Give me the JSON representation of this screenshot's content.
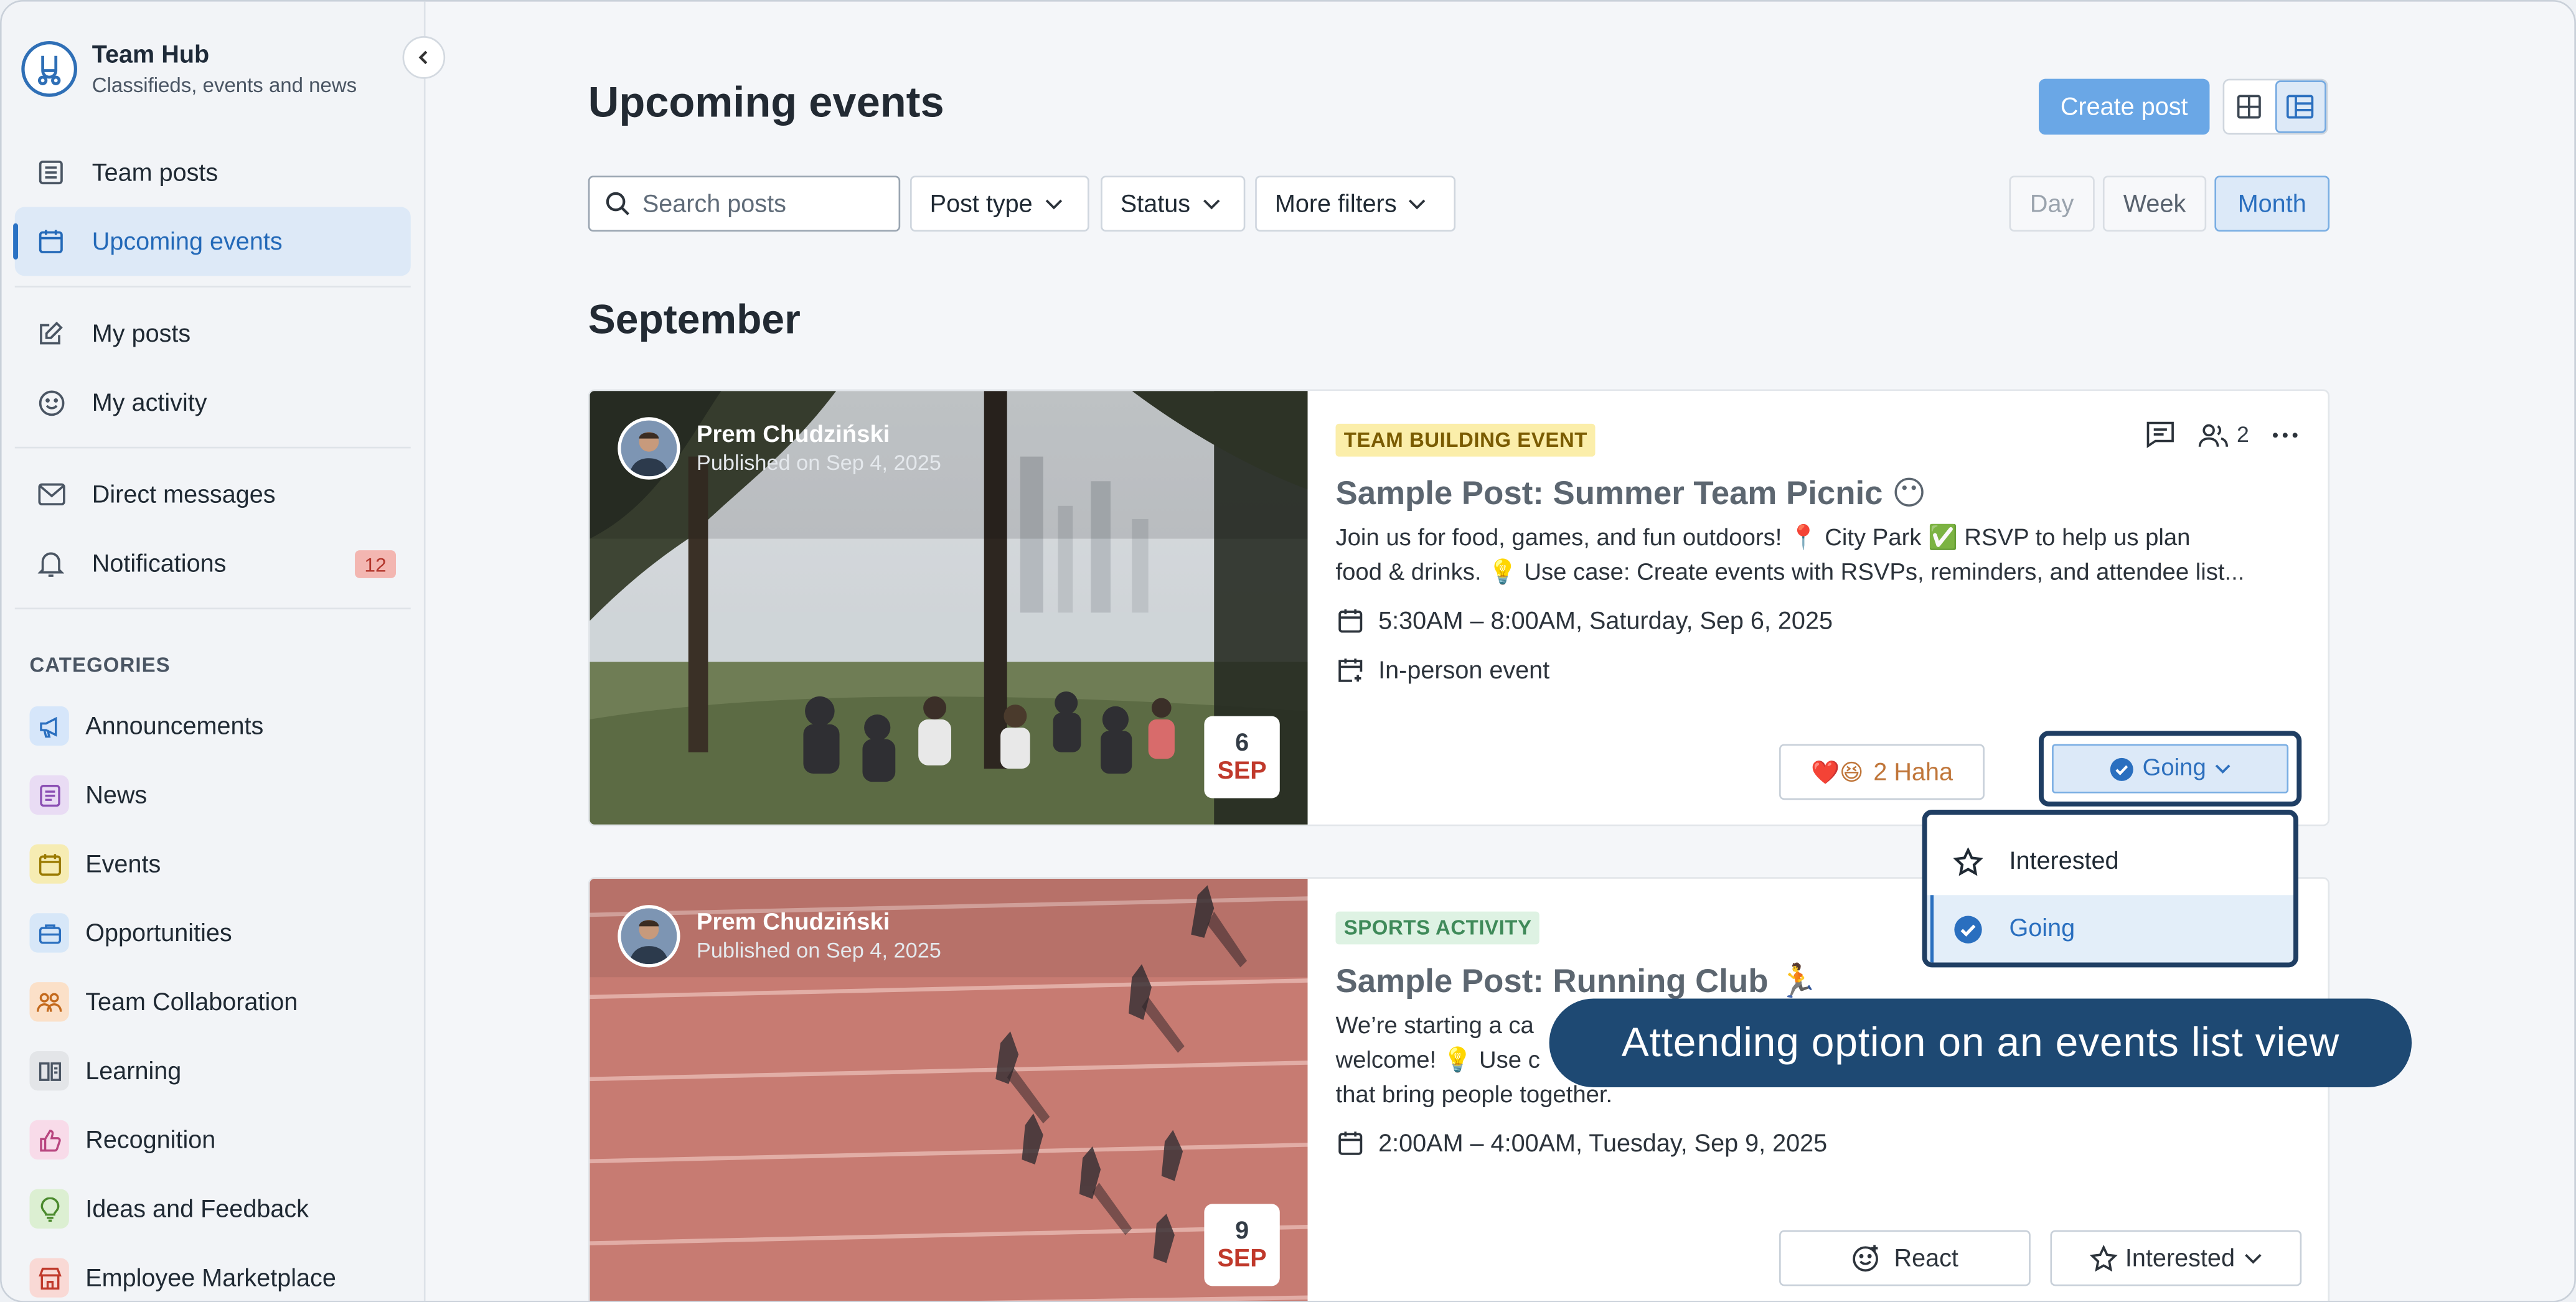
{
  "app": {
    "title": "Team Hub",
    "subtitle": "Classifieds, events and news"
  },
  "sidebar": {
    "nav": [
      {
        "label": "Team posts",
        "icon": "list-icon"
      },
      {
        "label": "Upcoming events",
        "icon": "calendar-icon",
        "active": true
      },
      {
        "label": "My posts",
        "icon": "edit-icon"
      },
      {
        "label": "My activity",
        "icon": "smile-icon"
      },
      {
        "label": "Direct messages",
        "icon": "mail-icon"
      },
      {
        "label": "Notifications",
        "icon": "bell-icon",
        "badge": "12"
      }
    ],
    "categories_title": "CATEGORIES",
    "categories": [
      {
        "label": "Announcements",
        "icon": "megaphone-icon",
        "color": "#d6e6fa"
      },
      {
        "label": "News",
        "icon": "document-icon",
        "color": "#e9dcf4"
      },
      {
        "label": "Events",
        "icon": "calendar-icon",
        "color": "#f6ecb3"
      },
      {
        "label": "Opportunities",
        "icon": "briefcase-icon",
        "color": "#d7e7f8"
      },
      {
        "label": "Team Collaboration",
        "icon": "people-icon",
        "color": "#fbe0c8"
      },
      {
        "label": "Learning",
        "icon": "book-icon",
        "color": "#e3e5e8"
      },
      {
        "label": "Recognition",
        "icon": "thumbs-up-icon",
        "color": "#f8dbe9"
      },
      {
        "label": "Ideas and Feedback",
        "icon": "lightbulb-icon",
        "color": "#dcefd2"
      },
      {
        "label": "Employee Marketplace",
        "icon": "store-icon",
        "color": "#f9d9d5"
      }
    ]
  },
  "header": {
    "title": "Upcoming events",
    "create_label": "Create post"
  },
  "filters": {
    "search_placeholder": "Search posts",
    "post_type": "Post type",
    "status": "Status",
    "more": "More filters",
    "ranges": [
      "Day",
      "Week",
      "Month"
    ],
    "active_range": "Month"
  },
  "section": {
    "month": "September"
  },
  "posts": [
    {
      "author": "Prem Chudziński",
      "published": "Published on Sep 4, 2025",
      "day": "6",
      "month": "SEP",
      "tag": "TEAM BUILDING EVENT",
      "title": "Sample Post: Summer Team Picnic 😶",
      "desc1": "Join us for food, games, and fun outdoors! 📍 City Park ✅ RSVP to help us plan",
      "desc2": "food & drinks. 💡 Use case: Create events with RSVPs, reminders, and attendee list...",
      "time": "5:30AM – 8:00AM, Saturday, Sep 6, 2025",
      "location": "In-person event",
      "attendees": "2",
      "reaction": "2 Haha",
      "reaction_emoji": "❤️😆",
      "rsvp": "Going"
    },
    {
      "author": "Prem Chudziński",
      "published": "Published on Sep 4, 2025",
      "day": "9",
      "month": "SEP",
      "tag": "SPORTS ACTIVITY",
      "title": "Sample Post: Running Club 🏃",
      "desc1": "We’re starting a ca",
      "desc2": "welcome! 💡 Use c",
      "desc3": "that bring people together.",
      "time": "2:00AM – 4:00AM, Tuesday, Sep 9, 2025",
      "react": "React",
      "rsvp": "Interested"
    }
  ],
  "dropdown": {
    "options": [
      "Interested",
      "Going"
    ],
    "selected": "Going"
  },
  "callout": "Attending option on an events list view"
}
